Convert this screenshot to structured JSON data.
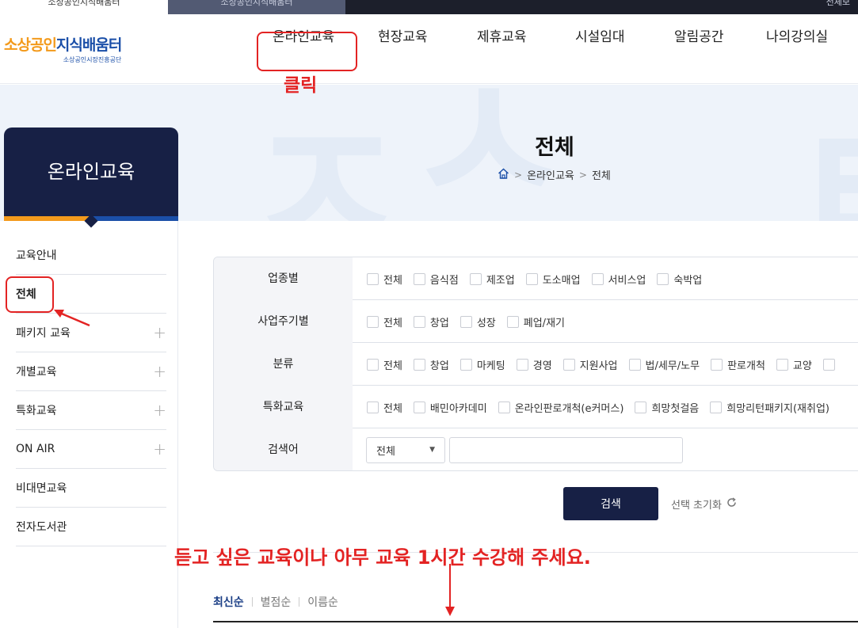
{
  "top_strip": {
    "tab1": "소상공인지식배움터",
    "tab2": "소상공인지식배움터",
    "tab3": "전체보"
  },
  "logo": {
    "main_orange": "소상공인",
    "main_blue": "지식배움터",
    "sub": "소상공인시장진흥공단"
  },
  "gnb": {
    "items": [
      "온라인교육",
      "현장교육",
      "제휴교육",
      "시설임대",
      "알림공간",
      "나의강의실"
    ]
  },
  "annotations": {
    "click": "클릭",
    "instruction": "듣고 싶은 교육이나 아무 교육 1시간 수강해 주세요."
  },
  "hero": {
    "title": "전체",
    "breadcrumb": [
      "온라인교육",
      "전체"
    ]
  },
  "sidebar": {
    "title": "온라인교육",
    "items": [
      {
        "label": "교육안내",
        "expandable": false
      },
      {
        "label": "전체",
        "expandable": false
      },
      {
        "label": "패키지 교육",
        "expandable": true
      },
      {
        "label": "개별교육",
        "expandable": true
      },
      {
        "label": "특화교육",
        "expandable": true
      },
      {
        "label": "ON AIR",
        "expandable": true
      },
      {
        "label": "비대면교육",
        "expandable": false
      },
      {
        "label": "전자도서관",
        "expandable": false
      }
    ]
  },
  "filter": {
    "rows": [
      {
        "label": "업종별",
        "options": [
          "전체",
          "음식점",
          "제조업",
          "도소매업",
          "서비스업",
          "숙박업"
        ]
      },
      {
        "label": "사업주기별",
        "options": [
          "전체",
          "창업",
          "성장",
          "폐업/재기"
        ]
      },
      {
        "label": "분류",
        "options": [
          "전체",
          "창업",
          "마케팅",
          "경영",
          "지원사업",
          "법/세무/노무",
          "판로개척",
          "교양"
        ]
      },
      {
        "label": "특화교육",
        "options": [
          "전체",
          "배민아카데미",
          "온라인판로개척(e커머스)",
          "희망첫걸음",
          "희망리턴패키지(재취업)"
        ]
      }
    ],
    "search_label": "검색어",
    "search_select": "전체",
    "search_value": ""
  },
  "actions": {
    "search": "검색",
    "reset": "선택 초기화"
  },
  "sort": [
    "최신순",
    "별점순",
    "이름순"
  ],
  "colors": {
    "navy": "#172045",
    "accent_orange": "#f39a1c",
    "accent_blue": "#1b4fa8",
    "annotation_red": "#e32323"
  }
}
